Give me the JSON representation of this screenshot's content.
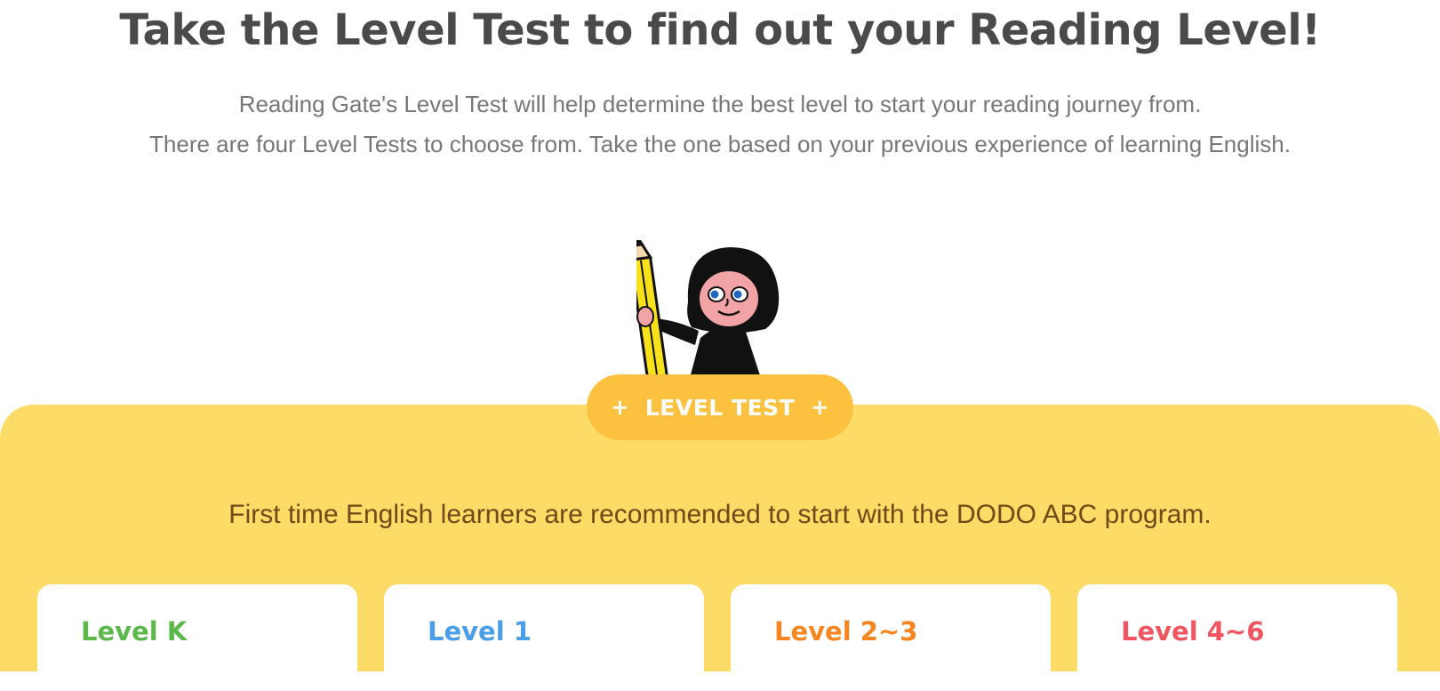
{
  "header": {
    "title": "Take the Level Test to find out your Reading Level!",
    "subtitle_line1": "Reading Gate's Level Test will help determine the best level to start your reading journey from.",
    "subtitle_line2": "There are four Level Tests to choose from. Take the one based on your previous experience of learning English."
  },
  "level_test": {
    "badge_label": "LEVEL TEST",
    "badge_plus": "+",
    "recommendation": "First time English learners are recommended to start with the DODO ABC program."
  },
  "levels": [
    {
      "label": "Level K",
      "color": "#5cb84a"
    },
    {
      "label": "Level 1",
      "color": "#4a9ee8"
    },
    {
      "label": "Level 2~3",
      "color": "#f7851f"
    },
    {
      "label": "Level 4~6",
      "color": "#f05561"
    }
  ],
  "colors": {
    "panel": "#fcdb67",
    "badge": "#fcc13f",
    "title": "#4a4a48"
  }
}
